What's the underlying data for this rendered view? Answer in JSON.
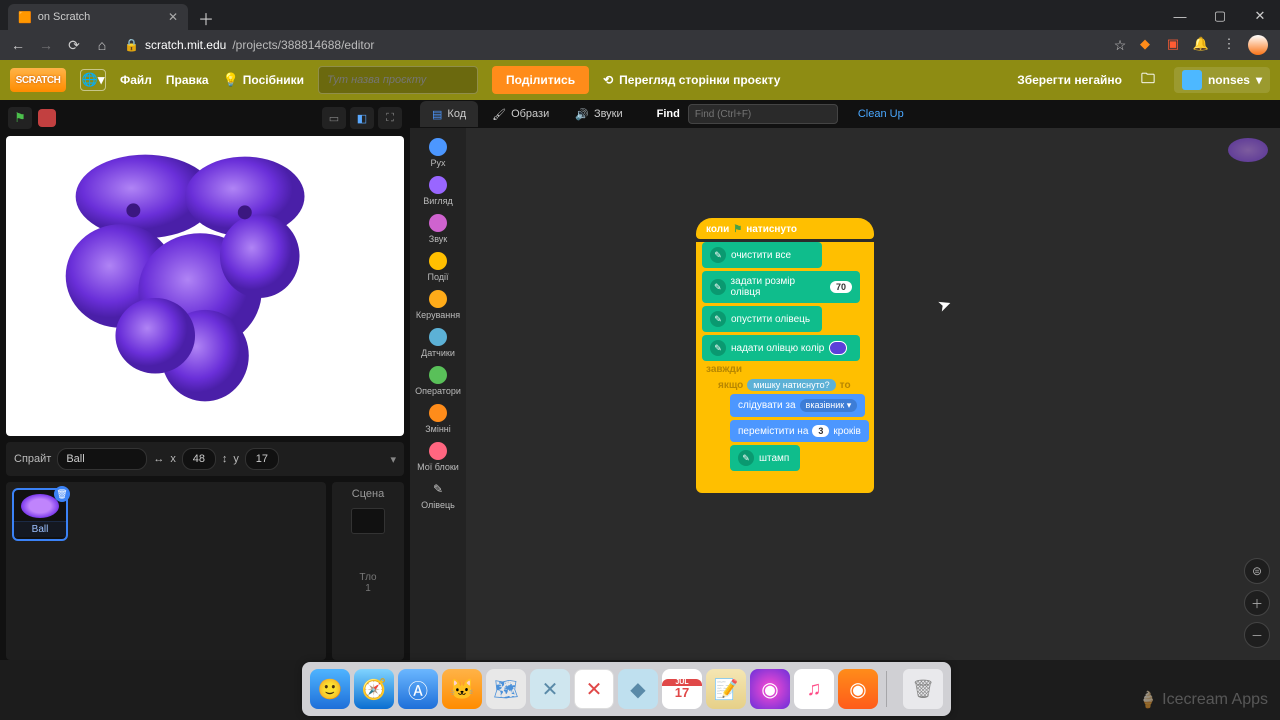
{
  "browser": {
    "tab_title": "on Scratch",
    "url_host": "scratch.mit.edu",
    "url_path": "/projects/388814688/editor"
  },
  "topbar": {
    "logo": "SCRATCH",
    "menu_file": "Файл",
    "menu_edit": "Правка",
    "tutorials": "Посібники",
    "title_placeholder": "Тут назва проєкту",
    "share": "Поділитись",
    "see_page": "Перегляд сторінки проєкту",
    "save_now": "Зберегти негайно",
    "username": "nonses"
  },
  "tabs": {
    "code": "Код",
    "costumes": "Образи",
    "sounds": "Звуки"
  },
  "find": {
    "label": "Find",
    "placeholder": "Find (Ctrl+F)",
    "cleanup": "Clean Up"
  },
  "categories": [
    {
      "label": "Рух",
      "color": "#4c97ff"
    },
    {
      "label": "Вигляд",
      "color": "#9966ff"
    },
    {
      "label": "Звук",
      "color": "#cf63cf"
    },
    {
      "label": "Події",
      "color": "#ffbf00"
    },
    {
      "label": "Керування",
      "color": "#ffab19"
    },
    {
      "label": "Датчики",
      "color": "#5cb1d6"
    },
    {
      "label": "Оператори",
      "color": "#59c059"
    },
    {
      "label": "Змінні",
      "color": "#ff8c1a"
    },
    {
      "label": "Мої блоки",
      "color": "#ff6680"
    },
    {
      "label": "Олівець",
      "color": "",
      "icon": "✎"
    }
  ],
  "sprite_info": {
    "label": "Спрайт",
    "name": "Ball",
    "x_label": "x",
    "x": "48",
    "y_label": "y",
    "y": "17"
  },
  "sprite_card": {
    "name": "Ball"
  },
  "stage_panel": {
    "title": "Сцена",
    "backdrop_lbl": "Тло",
    "backdrop_count": "1"
  },
  "blocks": {
    "hat_when": "коли",
    "hat_clicked": "натиснуто",
    "erase_all": "очистити все",
    "pen_size": "задати розмір олівця",
    "pen_size_val": "70",
    "pen_down": "опустити олівець",
    "pen_color": "надати олівцю колір",
    "forever": "завжди",
    "if": "якщо",
    "then": "то",
    "mouse_down": "мишку натиснуто?",
    "follow": "слідувати за",
    "pointer": "вказівник ▾",
    "move": "перемістити на",
    "move_val": "3",
    "move_steps": "кроків",
    "stamp": "штамп"
  },
  "watermark": "Icecream Apps"
}
